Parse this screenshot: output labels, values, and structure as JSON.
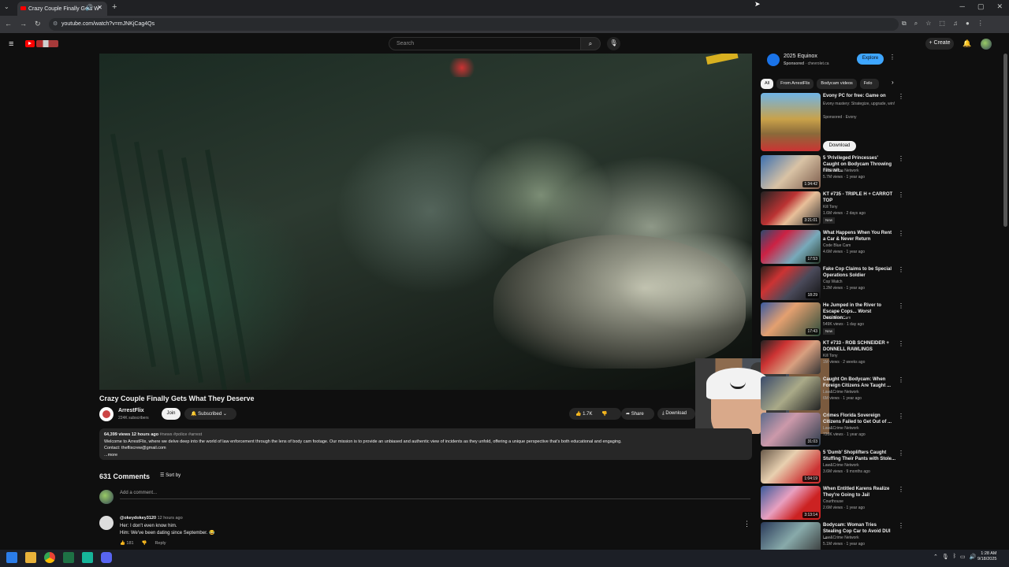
{
  "browser": {
    "tab_title": "Crazy Couple Finally Gets W",
    "url": "youtube.com/watch?v=mJNKjCag4Qs",
    "new_tab": "+",
    "window_controls": [
      "─",
      "▢",
      "✕"
    ]
  },
  "youtube_header": {
    "search_placeholder": "Search",
    "create_label": "Create"
  },
  "video": {
    "title": "Crazy Couple Finally Gets What They Deserve",
    "channel": "ArrestFlix",
    "subscribers": "224K subscribers",
    "join_label": "Join",
    "subscribed_label": "Subscribed",
    "likes": "1.7K",
    "share_label": "Share",
    "download_label": "Download",
    "views_time": "64,399 views  12 hours ago",
    "tags": "#news #police #arrest",
    "description": "Welcome to ArrestFlix, where we delve deep into the world of law enforcement through the lens of body cam footage. Our mission is to provide an unbiased and authentic view of incidents as they unfold, offering a unique perspective that's both educational and engaging.",
    "contact": "Contact: theflixcrew@gmail.com",
    "more_label": "...more"
  },
  "comments": {
    "count": "631 Comments",
    "sort_label": "Sort by",
    "add_placeholder": "Add a comment...",
    "items": [
      {
        "user": "@okeydokey3120",
        "time": "12 hours ago",
        "line1": "Her: I don't even know him.",
        "line2": "Him: We've been dating since September. 😂",
        "likes": "181",
        "reply_label": "Reply"
      }
    ]
  },
  "sidebar": {
    "ad": {
      "title": "2025 Equinox",
      "sponsored": "Sponsored",
      "domain": "chevrolet.ca",
      "button": "Explore"
    },
    "chips": [
      "All",
      "From ArrestFlix",
      "Bodycam videos",
      "Felo"
    ],
    "evony": {
      "title": "Evony PC for free: Game on",
      "desc": "Evony mastery: Strategize, upgrade, win!",
      "sponsored": "Sponsored · Evony",
      "download": "Download"
    },
    "videos": [
      {
        "title": "5 'Privileged Princesses' Caught on Bodycam Throwing Fits wit...",
        "channel": "Law&Crime Network",
        "meta": "5.7M views · 1 year ago",
        "duration": "1:34:42",
        "new": ""
      },
      {
        "title": "KT #735 - TRIPLE H + CARROT TOP",
        "channel": "Kill Tony",
        "meta": "1.6M views · 2 days ago",
        "duration": "3:21:01",
        "new": "New"
      },
      {
        "title": "What Happens When You Rent a Car & Never Return",
        "channel": "Code Blue Cam",
        "meta": "4.6M views · 1 year ago",
        "duration": "17:53",
        "new": ""
      },
      {
        "title": "Fake Cop Claims to be Special Operations Soldier",
        "channel": "Cop Watch",
        "meta": "1.2M views · 1 year ago",
        "duration": "18:29",
        "new": ""
      },
      {
        "title": "He Jumped in the River to Escape Cops... Worst Decision...",
        "channel": "Code Blue Cam",
        "meta": "549K views · 1 day ago",
        "duration": "17:43",
        "new": "New"
      },
      {
        "title": "KT #733 - ROB SCHNEIDER + DONNELL RAWLINGS",
        "channel": "Kill Tony",
        "meta": "1M views · 2 weeks ago",
        "duration": "",
        "new": ""
      },
      {
        "title": "Caught On Bodycam: When Foreign Citizens Are Taught ...",
        "channel": "Law&Crime Network",
        "meta": "6M views · 1 year ago",
        "duration": "",
        "new": ""
      },
      {
        "title": "Crimes Florida Sovereign Citizens Failed to Get Out of ...",
        "channel": "Law&Crime Network",
        "meta": "720K views · 1 year ago",
        "duration": "31:03",
        "new": ""
      },
      {
        "title": "5 'Dumb' Shoplifters Caught Stuffing Their Pants with Stole...",
        "channel": "Law&Crime Network",
        "meta": "3.6M views · 9 months ago",
        "duration": "1:04:19",
        "new": ""
      },
      {
        "title": "When Entitled Karens Realize They're Going to Jail",
        "channel": "Courthouse",
        "meta": "2.6M views · 1 year ago",
        "duration": "3:13:14",
        "new": ""
      },
      {
        "title": "Bodycam: Woman Tries Stealing Cop Car to Avoid DUI ...",
        "channel": "Law&Crime Network",
        "meta": "5.1M views · 1 year ago",
        "duration": "",
        "new": ""
      }
    ]
  },
  "taskbar": {
    "time": "1:28 AM",
    "date": "9/18/2025"
  }
}
